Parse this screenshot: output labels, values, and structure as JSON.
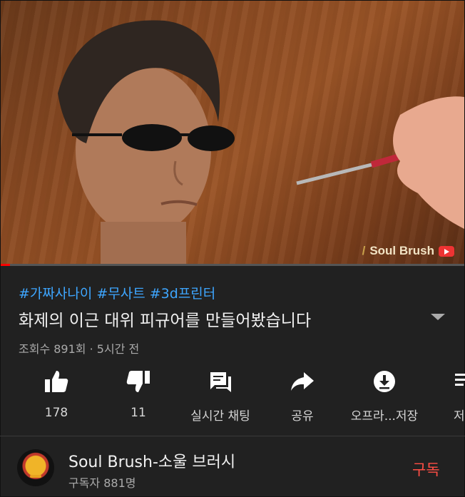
{
  "video": {
    "watermark_text": "Soul Brush",
    "progress_fraction": 0.02
  },
  "info": {
    "hashtags": "#가짜사나이 #무사트 #3d프린터",
    "title": "화제의 이근 대위 피규어를 만들어봤습니다",
    "meta": "조회수 891회 · 5시간 전"
  },
  "actions": [
    {
      "icon": "thumbs-up-icon",
      "label": "178"
    },
    {
      "icon": "thumbs-down-icon",
      "label": "11"
    },
    {
      "icon": "live-chat-icon",
      "label": "실시간 채팅"
    },
    {
      "icon": "share-icon",
      "label": "공유"
    },
    {
      "icon": "download-icon",
      "label": "오프라...저장"
    },
    {
      "icon": "save-icon",
      "label": "저"
    }
  ],
  "channel": {
    "name": "Soul Brush-소울 브러시",
    "subscribers": "구독자 881명",
    "subscribe_label": "구독"
  },
  "colors": {
    "background": "#212121",
    "link": "#3ea6ff",
    "subscribe": "#ff4e45",
    "progress": "#ff0000"
  }
}
